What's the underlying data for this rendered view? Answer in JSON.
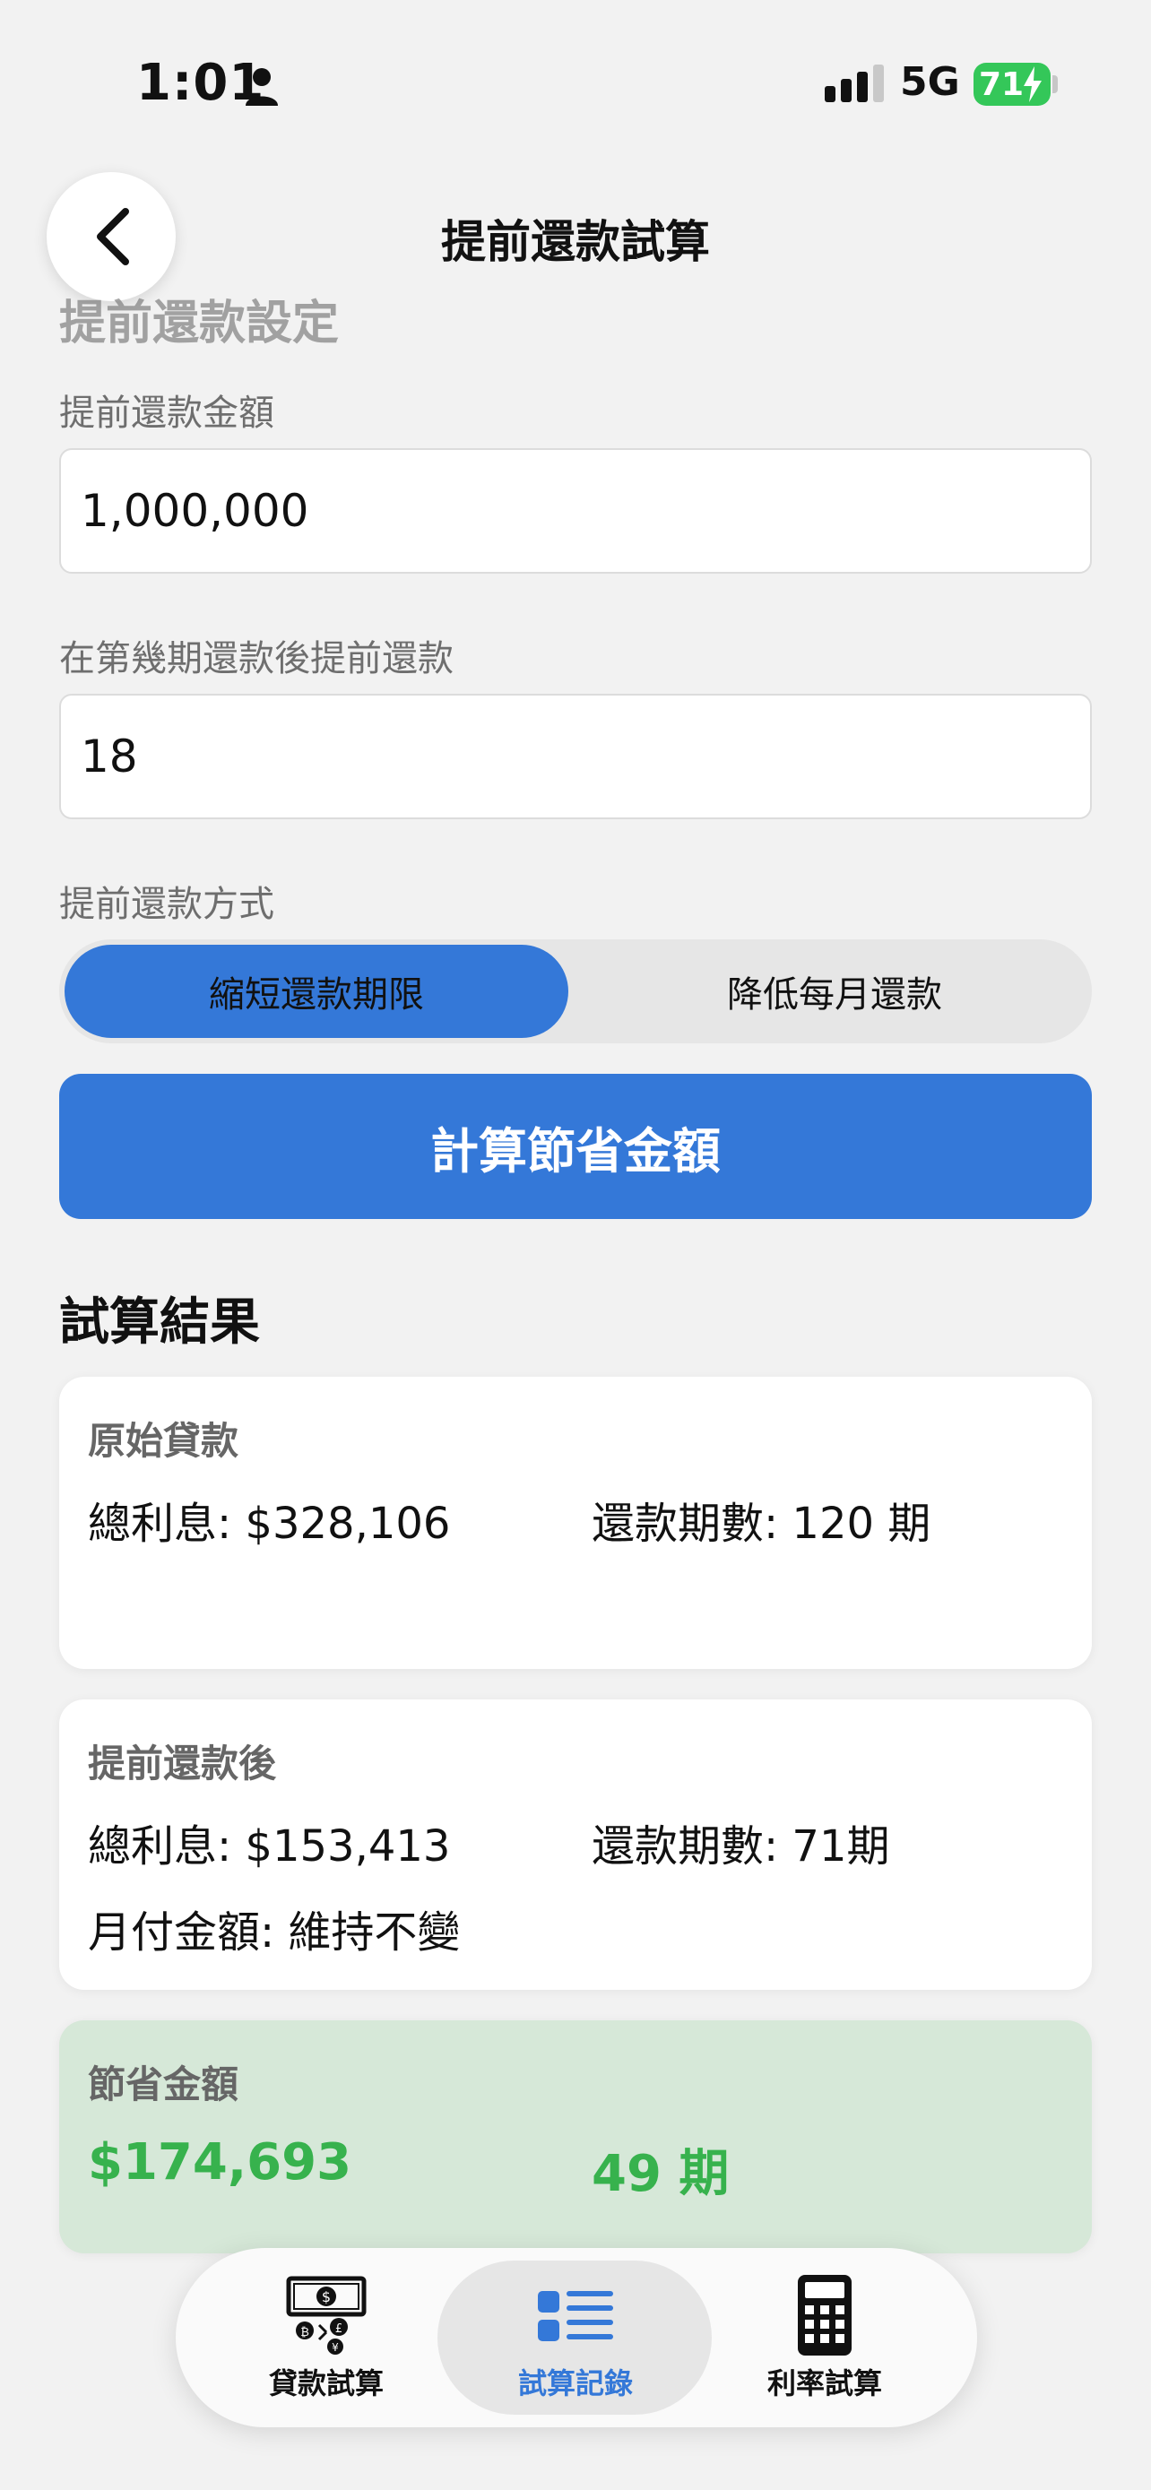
{
  "status_bar": {
    "time": "1:01",
    "network": "5G",
    "battery": "71"
  },
  "nav": {
    "title": "提前還款試算"
  },
  "settings": {
    "section_title": "提前還款設定",
    "amount_label": "提前還款金額",
    "amount_value": "1,000,000",
    "period_label": "在第幾期還款後提前還款",
    "period_value": "18",
    "method_label": "提前還款方式",
    "method_options": [
      "縮短還款期限",
      "降低每月還款"
    ],
    "selected_method": "縮短還款期限",
    "calculate_button": "計算節省金額"
  },
  "results": {
    "title": "試算結果",
    "original": {
      "title": "原始貸款",
      "interest": "總利息: $328,106",
      "periods": "還款期數: 120 期"
    },
    "after": {
      "title": "提前還款後",
      "interest": "總利息: $153,413",
      "periods": "還款期數: 71期",
      "monthly": "月付金額: 維持不變"
    },
    "savings": {
      "title": "節省金額",
      "amount": "$174,693",
      "periods": "49 期"
    }
  },
  "tabbar": {
    "items": [
      {
        "label": "貸款試算",
        "icon": "money-exchange-icon"
      },
      {
        "label": "試算記錄",
        "icon": "list-icon",
        "active": true
      },
      {
        "label": "利率試算",
        "icon": "calculator-icon"
      }
    ]
  },
  "colors": {
    "accent": "#3478d8",
    "savings_green": "#37b24d",
    "battery_green": "#34c759"
  }
}
